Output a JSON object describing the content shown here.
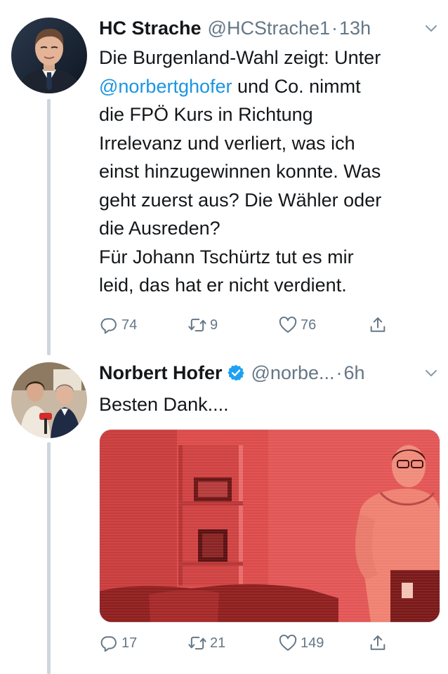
{
  "tweets": [
    {
      "name": "HC Strache",
      "handle": "@HCStrache1",
      "separator": "·",
      "time": "13h",
      "verified": false,
      "avatar_icon": "avatar-photo-icon",
      "text_lines": [
        {
          "parts": [
            {
              "text": "Die Burgenland-Wahl zeigt: Unter",
              "mention": false
            }
          ]
        },
        {
          "parts": [
            {
              "text": "@norbertghofer",
              "mention": true
            },
            {
              "text": " und Co. nimmt",
              "mention": false
            }
          ]
        },
        {
          "parts": [
            {
              "text": "die FPÖ Kurs in Richtung",
              "mention": false
            }
          ]
        },
        {
          "parts": [
            {
              "text": "Irrelevanz und verliert, was ich",
              "mention": false
            }
          ]
        },
        {
          "parts": [
            {
              "text": "einst hinzugewinnen konnte. Was",
              "mention": false
            }
          ]
        },
        {
          "parts": [
            {
              "text": "geht zuerst aus? Die Wähler oder",
              "mention": false
            }
          ]
        },
        {
          "parts": [
            {
              "text": "die Ausreden?",
              "mention": false
            }
          ]
        },
        {
          "parts": [
            {
              "text": "Für Johann Tschürtz tut es mir",
              "mention": false
            }
          ]
        },
        {
          "parts": [
            {
              "text": "leid, das hat er nicht verdient.",
              "mention": false
            }
          ]
        }
      ],
      "replies": "74",
      "retweets": "9",
      "likes": "76"
    },
    {
      "name": "Norbert Hofer",
      "handle": "@norbe...",
      "separator": "·",
      "time": "6h",
      "verified": true,
      "avatar_icon": "avatar-photo-icon",
      "text_lines": [
        {
          "parts": [
            {
              "text": "Besten Dank....",
              "mention": false
            }
          ]
        }
      ],
      "media_icon": "photo-icon",
      "replies": "17",
      "retweets": "21",
      "likes": "149"
    }
  ],
  "colors": {
    "text": "#14171a",
    "secondary": "#657786",
    "mention": "#1b95e0",
    "verified": "#1da1f2",
    "thread_line": "#ccd6dd",
    "media_tint": "#d93a3a"
  },
  "icons": {
    "reply": "reply-icon",
    "retweet": "retweet-icon",
    "like": "heart-icon",
    "share": "share-icon",
    "more": "chevron-down-icon",
    "verified": "verified-badge-icon"
  }
}
